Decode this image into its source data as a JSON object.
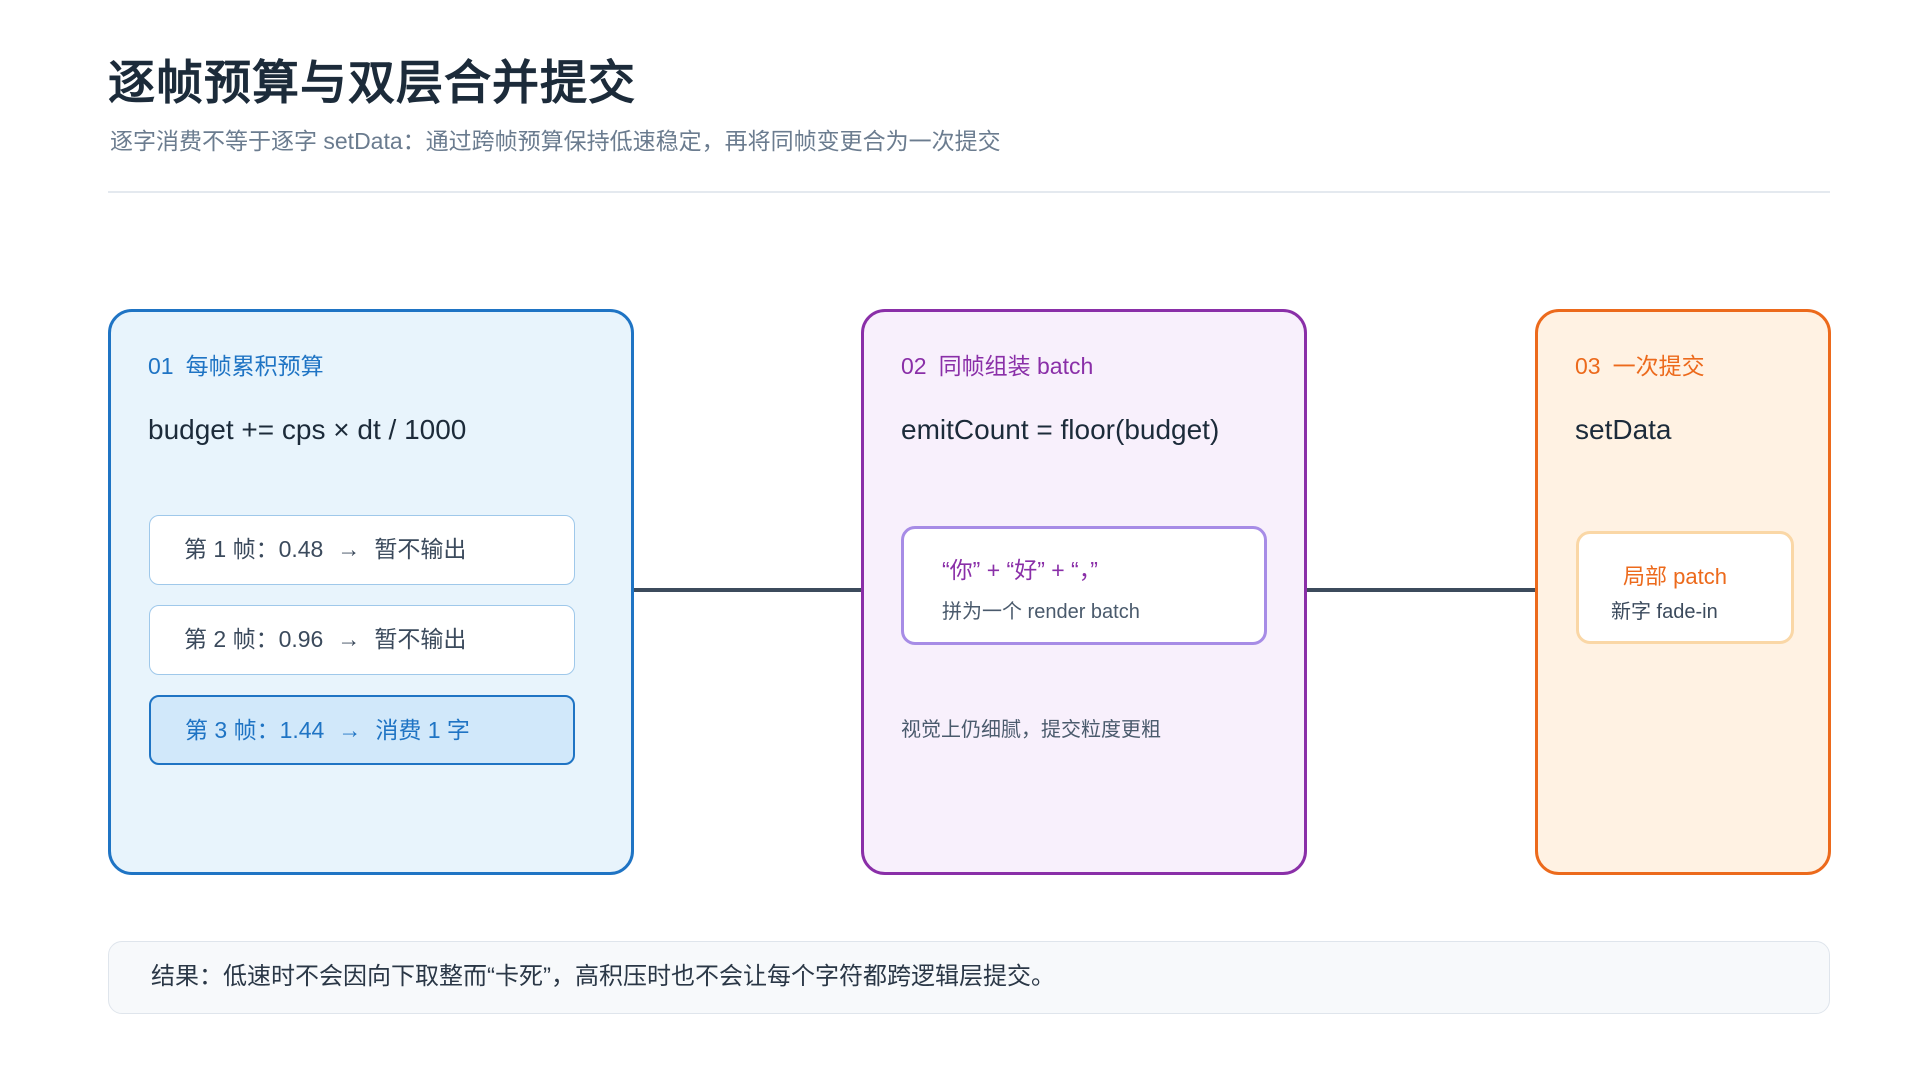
{
  "title": "逐帧预算与双层合并提交",
  "subtitle": "逐字消费不等于逐字 setData：通过跨帧预算保持低速稳定，再将同帧变更合为一次提交",
  "colors": {
    "blue": "#1f74c4",
    "purple": "#8a2fa8",
    "orange": "#ec6a1c",
    "connector": "#3c4b5c"
  },
  "cards": [
    {
      "num": "01",
      "label": "每帧累积预算",
      "formula": "budget += cps × dt / 1000",
      "frames": [
        {
          "label": "第 1 帧：0.48",
          "arrow": "→",
          "result": "暂不输出"
        },
        {
          "label": "第 2 帧：0.96",
          "arrow": "→",
          "result": "暂不输出"
        },
        {
          "label": "第 3 帧：1.44",
          "arrow": "→",
          "result": "消费 1 字"
        }
      ]
    },
    {
      "num": "02",
      "label": "同帧组装 batch",
      "formula": "emitCount = floor(budget)",
      "batch_tokens": "“你” + “好” + “，”",
      "batch_note": "拼为一个 render batch",
      "note": "视觉上仍细腻，提交粒度更粗"
    },
    {
      "num": "03",
      "label": "一次提交",
      "formula": "setData",
      "patch_label": "局部 patch",
      "patch_note": "新字 fade-in"
    }
  ],
  "result": "结果：低速时不会因向下取整而“卡死”，高积压时也不会让每个字符都跨逻辑层提交。"
}
